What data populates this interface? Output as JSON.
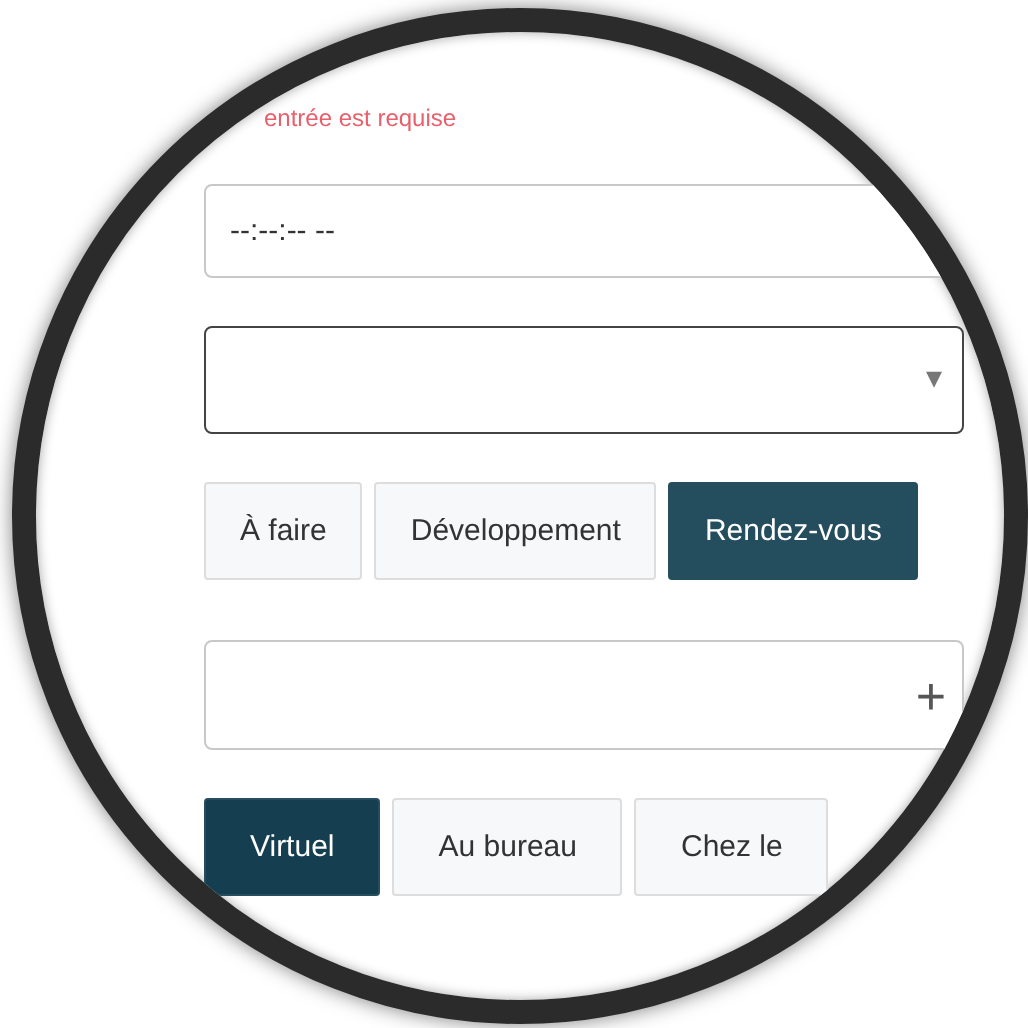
{
  "error_message": "entrée est requise",
  "time_field": {
    "placeholder": "--:--:-- --"
  },
  "dropdown": {
    "caret": "▾"
  },
  "category_buttons": [
    {
      "label": "À faire",
      "selected": false
    },
    {
      "label": "Développement",
      "selected": false
    },
    {
      "label": "Rendez-vous",
      "selected": true
    }
  ],
  "add_field": {
    "icon": "+"
  },
  "location_buttons": [
    {
      "label": "Virtuel",
      "selected": true
    },
    {
      "label": "Au bureau",
      "selected": false
    },
    {
      "label": "Chez le",
      "selected": false
    }
  ]
}
